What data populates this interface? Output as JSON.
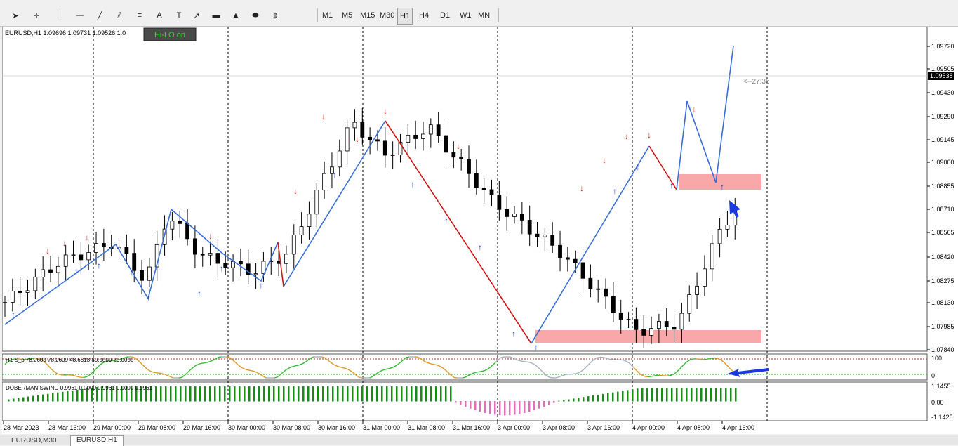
{
  "toolbar": {
    "tools": [
      {
        "name": "cursor-icon"
      },
      {
        "name": "crosshair-icon"
      },
      {
        "name": "vertical-line-icon"
      },
      {
        "name": "horizontal-line-icon"
      },
      {
        "name": "trendline-icon"
      },
      {
        "name": "channel-icon"
      },
      {
        "name": "fibonacci-icon"
      },
      {
        "name": "text-icon"
      },
      {
        "name": "text-label-icon"
      },
      {
        "name": "arrow-icon"
      },
      {
        "name": "rectangle-icon"
      },
      {
        "name": "triangle-icon"
      },
      {
        "name": "ellipse-icon"
      },
      {
        "name": "more-shapes-icon"
      }
    ],
    "timeframes": [
      "M1",
      "M5",
      "M15",
      "M30",
      "H1",
      "H4",
      "D1",
      "W1",
      "MN"
    ],
    "active_timeframe": "H1"
  },
  "chart": {
    "header": "EURUSD,H1  1.09696 1.09731 1.09526 1.0",
    "hilo_button": "Hi-LO on",
    "countdown": "<--27:35",
    "current_price_label": "1.09538",
    "price_axis": [
      "1.09720",
      "1.09505",
      "1.09430",
      "1.09290",
      "1.09145",
      "1.09000",
      "1.08855",
      "1.08710",
      "1.08565",
      "1.08420",
      "1.08275",
      "1.08130",
      "1.07985",
      "1.07840"
    ],
    "time_axis": [
      "28 Mar 2023",
      "28 Mar 16:00",
      "29 Mar 00:00",
      "29 Mar 08:00",
      "29 Mar 16:00",
      "30 Mar 00:00",
      "30 Mar 08:00",
      "30 Mar 16:00",
      "31 Mar 00:00",
      "31 Mar 08:00",
      "31 Mar 16:00",
      "3 Apr 00:00",
      "3 Apr 08:00",
      "3 Apr 16:00",
      "4 Apr 00:00",
      "4 Apr 08:00",
      "4 Apr 16:00"
    ],
    "osc1_label": "H1 S_p 78.2609 78.2609 48.6313 80.0000 20.0000",
    "osc1_axis": [
      "100",
      "0"
    ],
    "osc2_label": "DOBERMAN SWING 0.9961 0.0000 0.9961 0.0000 0.9961",
    "osc2_axis": [
      "1.1455",
      "0.00",
      "-1.1425"
    ],
    "colors": {
      "bull_swing": "#3a6fd8",
      "bear_swing": "#cc1414",
      "zone": "#f8a8a8",
      "hist_pos": "#178a17",
      "hist_neg": "#e070b8",
      "osc_up": "#33bb33",
      "osc_down": "#e09a22",
      "osc_neutral": "#a8b0bc",
      "arrow_up": "#1a3adf",
      "arrow_down": "#d81818"
    }
  },
  "tabs": [
    {
      "label": "EURUSD,M30",
      "active": false
    },
    {
      "label": "EURUSD,H1",
      "active": true
    }
  ]
}
